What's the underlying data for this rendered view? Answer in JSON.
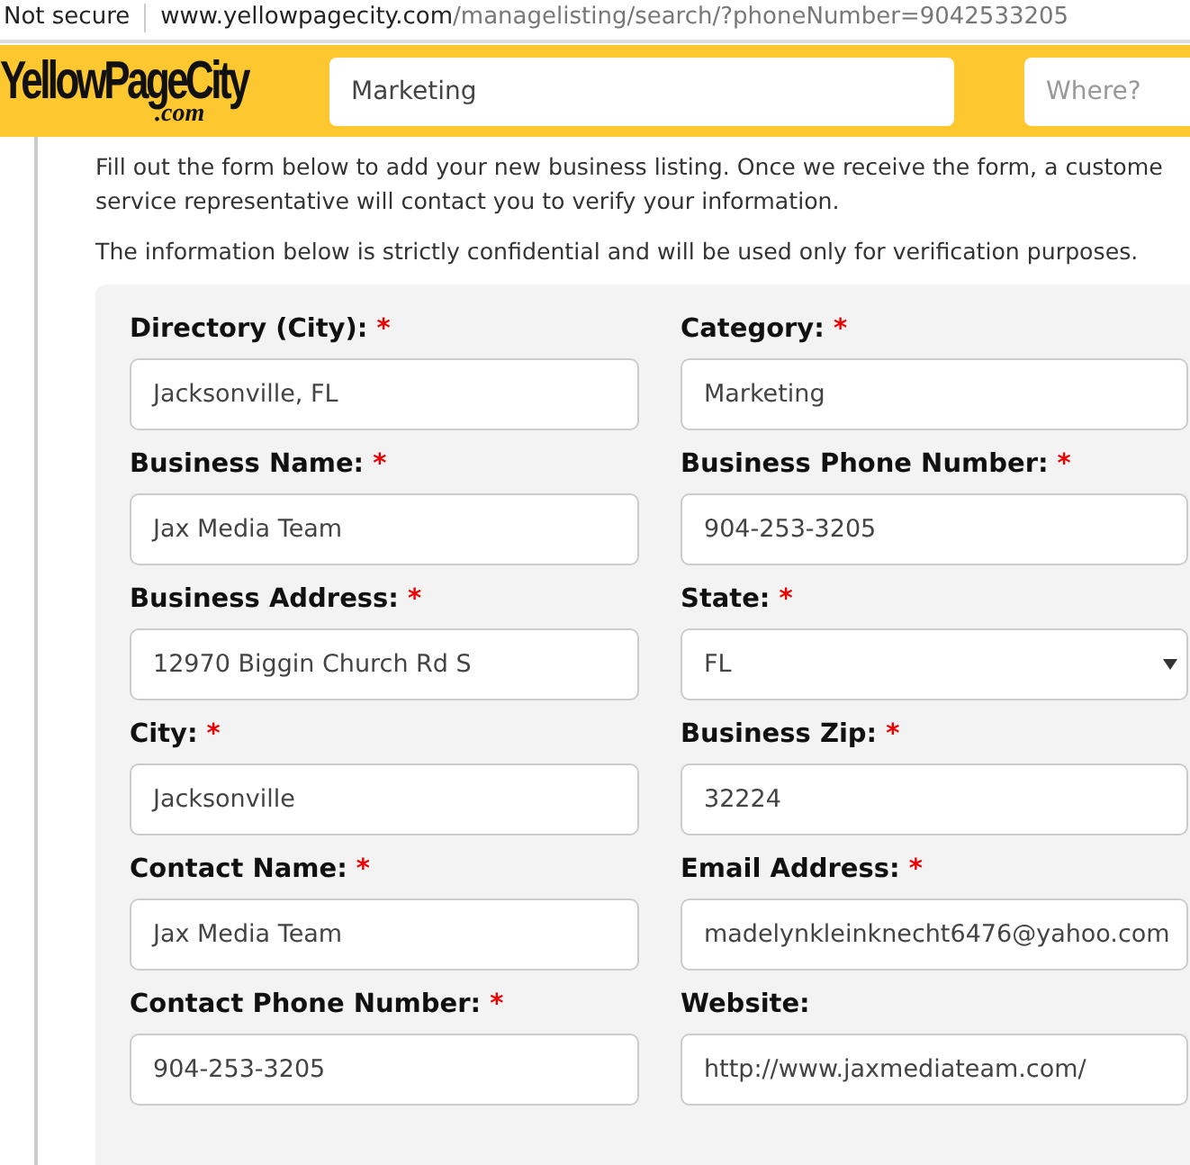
{
  "browser": {
    "security": "Not secure",
    "url_host": "www.yellowpagecity.com",
    "url_path": "/managelisting/search/?phoneNumber=9042533205"
  },
  "header": {
    "logo": "YellowPageCity",
    "logo_sub": ".com",
    "search_value": "Marketing",
    "where_placeholder": "Where?"
  },
  "intro": [
    "Fill out the form below to add your new business listing. Once we receive the form, a custome",
    "service representative will contact you to verify your information."
  ],
  "notice": "The information below is strictly confidential and will be used only for verification purposes.",
  "fields": [
    {
      "label": "Directory (City):",
      "required_mark": "*",
      "kind": "text",
      "value": "Jacksonville, FL"
    },
    {
      "label": "Category:",
      "required_mark": "*",
      "kind": "text",
      "value": "Marketing"
    },
    {
      "label": "Business Name:",
      "required_mark": "*",
      "kind": "text",
      "value": "Jax Media Team"
    },
    {
      "label": "Business Phone Number:",
      "required_mark": "*",
      "kind": "text",
      "value": "904-253-3205"
    },
    {
      "label": "Business Address:",
      "required_mark": "*",
      "kind": "text",
      "value": "12970 Biggin Church Rd S"
    },
    {
      "label": "State:",
      "required_mark": "*",
      "kind": "select",
      "value": "FL"
    },
    {
      "label": "City:",
      "required_mark": "*",
      "kind": "text",
      "value": "Jacksonville"
    },
    {
      "label": "Business Zip:",
      "required_mark": "*",
      "kind": "text",
      "value": "32224"
    },
    {
      "label": "Contact Name:",
      "required_mark": "*",
      "kind": "text",
      "value": "Jax Media Team"
    },
    {
      "label": "Email Address:",
      "required_mark": "*",
      "kind": "text",
      "value": "madelynkleinknecht6476@yahoo.com"
    },
    {
      "label": "Contact Phone Number:",
      "required_mark": "*",
      "kind": "text",
      "value": "904-253-3205"
    },
    {
      "label": "Website:",
      "kind": "text",
      "value": "http://www.jaxmediateam.com/"
    }
  ]
}
